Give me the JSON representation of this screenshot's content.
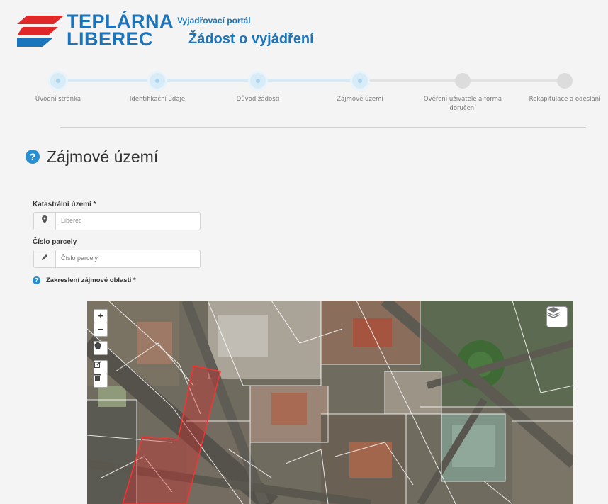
{
  "header": {
    "logo_line1": "TEPLÁRNA",
    "logo_line2": "LIBEREC",
    "portal_title": "Vyjadřovací portál",
    "page_heading": "Žádost o vyjádření"
  },
  "steps": [
    {
      "label": "Úvodní stránka",
      "state": "done"
    },
    {
      "label": "Identifikační údaje",
      "state": "done"
    },
    {
      "label": "Důvod žádosti",
      "state": "done"
    },
    {
      "label": "Zájmové území",
      "state": "current"
    },
    {
      "label": "Ověření uživatele a forma doručení",
      "state": "todo"
    },
    {
      "label": "Rekapitulace a odeslání",
      "state": "todo"
    }
  ],
  "section": {
    "title": "Zájmové území",
    "help_icon": "question-circle-icon"
  },
  "form": {
    "cadastral": {
      "label": "Katastrální území *",
      "icon": "map-marker-icon",
      "value": "Liberec"
    },
    "parcel": {
      "label": "Číslo parcely",
      "icon": "pencil-icon",
      "placeholder": "Číslo parcely"
    },
    "map_label": "Zakreslení zájmové oblasti *"
  },
  "map": {
    "zoom_in": "+",
    "zoom_out": "−",
    "layers_icon": "layers-icon",
    "draw_polygon_icon": "polygon-icon",
    "edit_icon": "edit-icon",
    "delete_icon": "trash-icon",
    "highlight_color": "#e02828"
  },
  "colors": {
    "brand_blue": "#1b75bc",
    "brand_red": "#e02828",
    "accent": "#2a8fd0"
  }
}
